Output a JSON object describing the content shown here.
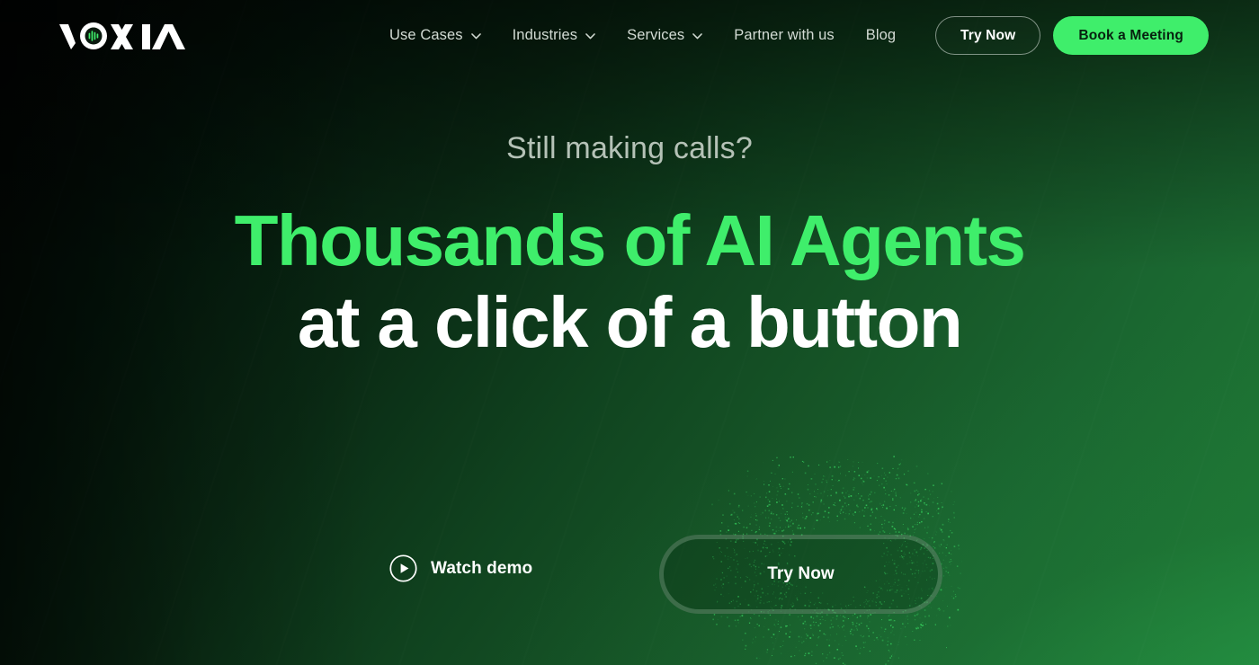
{
  "brand": {
    "name": "VOXIA",
    "logo_icon": "voxia-wordmark-with-waveform-o",
    "accent_green": "#3FEE6B",
    "headline_green": "#3FEE6B"
  },
  "nav": {
    "items": [
      {
        "label": "Use Cases",
        "has_dropdown": true,
        "icon": "chevron-down-icon"
      },
      {
        "label": "Industries",
        "has_dropdown": true,
        "icon": "chevron-down-icon"
      },
      {
        "label": "Services",
        "has_dropdown": true,
        "icon": "chevron-down-icon"
      },
      {
        "label": "Partner with us",
        "has_dropdown": false,
        "icon": ""
      },
      {
        "label": "Blog",
        "has_dropdown": false,
        "icon": ""
      }
    ],
    "actions": {
      "try_now_label": "Try Now",
      "book_meeting_label": "Book a Meeting"
    }
  },
  "hero": {
    "eyebrow": "Still making calls?",
    "headline_line_1": "Thousands of AI Agents",
    "headline_line_2": "at a click of a button"
  },
  "cta": {
    "watch_demo_label": "Watch demo",
    "watch_demo_icon": "play-circle-icon",
    "try_now_label": "Try Now"
  },
  "background": {
    "gradient_from": "#030705",
    "gradient_to": "#1f7c37",
    "particle_color": "#3FEE6B"
  }
}
